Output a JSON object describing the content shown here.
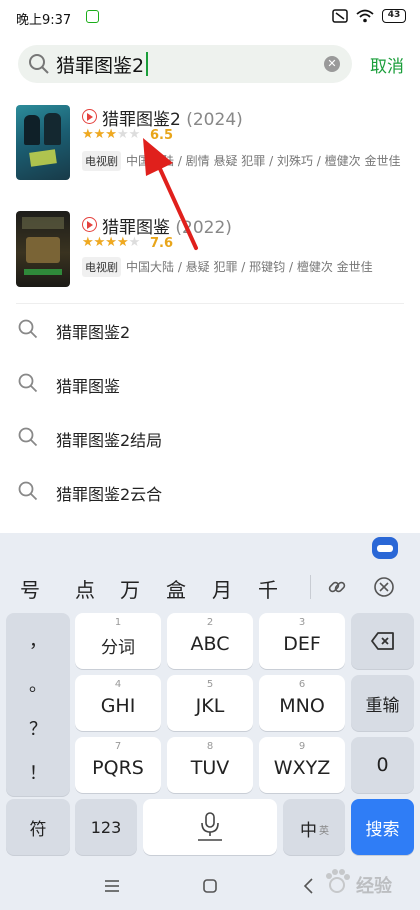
{
  "status_bar": {
    "time": "晚上9:37",
    "battery": "43"
  },
  "search": {
    "query": "猎罪图鉴2",
    "cancel_label": "取消"
  },
  "results": [
    {
      "title": "猎罪图鉴2",
      "year": "(2024)",
      "stars": "★★★★★",
      "rating": "6.5",
      "tag": "电视剧",
      "meta": "中国大陆 / 剧情 悬疑 犯罪 / 刘殊巧 / 檀健次 金世佳"
    },
    {
      "title": "猎罪图鉴",
      "year": "(2022)",
      "stars": "★★★★★",
      "rating": "7.6",
      "tag": "电视剧",
      "meta": "中国大陆 / 悬疑 犯罪 / 邢键钧 / 檀健次 金世佳"
    }
  ],
  "suggestions": [
    "猎罪图鉴2",
    "猎罪图鉴",
    "猎罪图鉴2结局",
    "猎罪图鉴2云合"
  ],
  "keyboard": {
    "candidates": [
      "号",
      "点",
      "万",
      "盒",
      "月",
      "千"
    ],
    "punct": [
      "，",
      "。",
      "？",
      "！"
    ],
    "rows": [
      {
        "keys": [
          {
            "num": "1",
            "label": "分词"
          },
          {
            "num": "2",
            "label": "ABC"
          },
          {
            "num": "3",
            "label": "DEF"
          }
        ]
      },
      {
        "keys": [
          {
            "num": "4",
            "label": "GHI"
          },
          {
            "num": "5",
            "label": "JKL"
          },
          {
            "num": "6",
            "label": "MNO"
          }
        ]
      },
      {
        "keys": [
          {
            "num": "7",
            "label": "PQRS"
          },
          {
            "num": "8",
            "label": "TUV"
          },
          {
            "num": "9",
            "label": "WXYZ"
          }
        ]
      }
    ],
    "reenter": "重输",
    "zero": "0",
    "symbol": "符",
    "num_mode": "123",
    "lang_main": "中",
    "lang_alt": "英",
    "search": "搜索"
  },
  "watermark": "经验"
}
